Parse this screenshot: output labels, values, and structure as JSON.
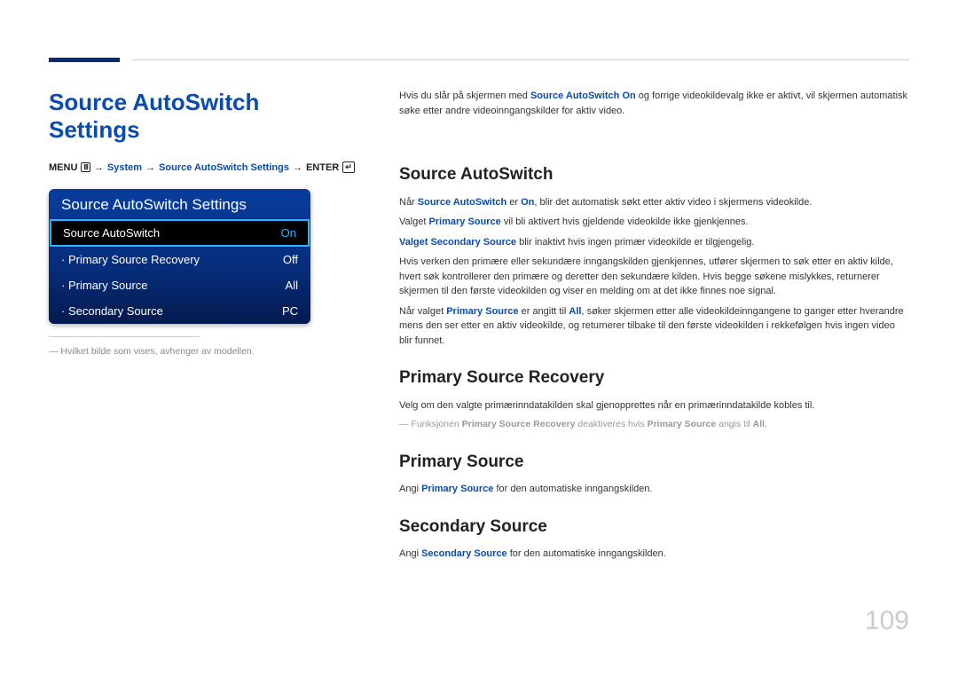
{
  "page": {
    "title": "Source AutoSwitch Settings",
    "number": "109"
  },
  "menuPath": {
    "menu": "MENU",
    "system": "System",
    "settings": "Source AutoSwitch Settings",
    "enter": "ENTER"
  },
  "panel": {
    "title": "Source AutoSwitch Settings",
    "rows": {
      "r0": {
        "label": "Source AutoSwitch",
        "value": "On"
      },
      "r1": {
        "label": "Primary Source Recovery",
        "value": "Off"
      },
      "r2": {
        "label": "Primary Source",
        "value": "All"
      },
      "r3": {
        "label": "Secondary Source",
        "value": "PC"
      }
    }
  },
  "footnote": "Hvilket bilde som vises, avhenger av modellen.",
  "body": {
    "intro1a": "Hvis du slår på skjermen med ",
    "intro1b": "Source AutoSwitch On",
    "intro1c": " og forrige videokildevalg ikke er aktivt, vil skjermen automatisk søke etter andre videoinngangskilder for aktiv video.",
    "h1": "Source AutoSwitch",
    "p1a": "Når ",
    "p1b": "Source AutoSwitch",
    "p1c": " er ",
    "p1d": "On",
    "p1e": ", blir det automatisk søkt etter aktiv video i skjermens videokilde.",
    "p2a": "Valget ",
    "p2b": "Primary Source",
    "p2c": " vil bli aktivert hvis gjeldende videokilde ikke gjenkjennes.",
    "p3a": "Valget Secondary Source",
    "p3b": " blir inaktivt hvis ingen primær videokilde er tilgjengelig.",
    "p4": "Hvis verken den primære eller sekundære inngangskilden gjenkjennes, utfører skjermen to søk etter en aktiv kilde, hvert søk kontrollerer den primære og deretter den sekundære kilden. Hvis begge søkene mislykkes, returnerer skjermen til den første videokilden og viser en melding om at det ikke finnes noe signal.",
    "p5a": "Når valget ",
    "p5b": "Primary Source",
    "p5c": " er angitt til ",
    "p5d": "All",
    "p5e": ", søker skjermen etter alle videokildeinngangene to ganger etter hverandre mens den ser etter en aktiv videokilde, og returnerer tilbake til den første videokilden i rekkefølgen hvis ingen video blir funnet.",
    "h2": "Primary Source Recovery",
    "p6": "Velg om den valgte primærinndatakilden skal gjenopprettes når en primærinndatakilde kobles til.",
    "n1a": "Funksjonen ",
    "n1b": "Primary Source Recovery",
    "n1c": " deaktiveres hvis ",
    "n1d": "Primary Source",
    "n1e": " angis til ",
    "n1f": "All",
    "n1g": ".",
    "h3": "Primary Source",
    "p7a": "Angi ",
    "p7b": "Primary Source",
    "p7c": " for den automatiske inngangskilden.",
    "h4": "Secondary Source",
    "p8a": "Angi ",
    "p8b": "Secondary Source",
    "p8c": " for den automatiske inngangskilden."
  }
}
